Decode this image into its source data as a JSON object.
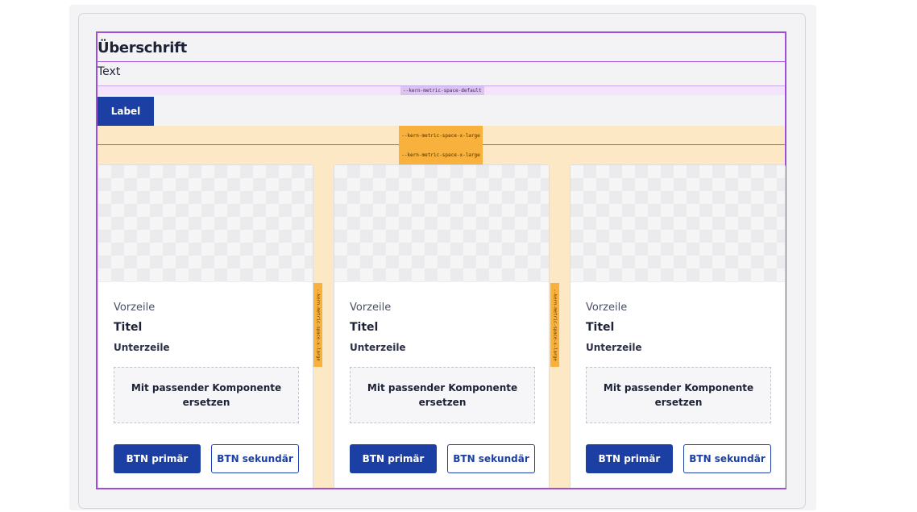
{
  "heading": "Überschrift",
  "text": "Text",
  "label": "Label",
  "spacing_tokens": {
    "default": "--kern-metric-space-default",
    "x_large": "--kern-metric-space-x-large"
  },
  "cards": [
    {
      "vorzeile": "Vorzeile",
      "titel": "Titel",
      "unterzeile": "Unterzeile",
      "placeholder": "Mit passender Komponente ersetzen",
      "primary": "BTN primär",
      "secondary": "BTN sekundär"
    },
    {
      "vorzeile": "Vorzeile",
      "titel": "Titel",
      "unterzeile": "Unterzeile",
      "placeholder": "Mit passender Komponente ersetzen",
      "primary": "BTN primär",
      "secondary": "BTN sekundär"
    },
    {
      "vorzeile": "Vorzeile",
      "titel": "Titel",
      "unterzeile": "Unterzeile",
      "placeholder": "Mit passender Komponente ersetzen",
      "primary": "BTN primär",
      "secondary": "BTN sekundär"
    }
  ],
  "colors": {
    "primary": "#1c3fa3",
    "outline": "#9d4fd9",
    "spacing_large": "#f7b13c",
    "spacing_large_bg": "#fde8c6",
    "spacing_default_bg": "#f3e4fb"
  }
}
